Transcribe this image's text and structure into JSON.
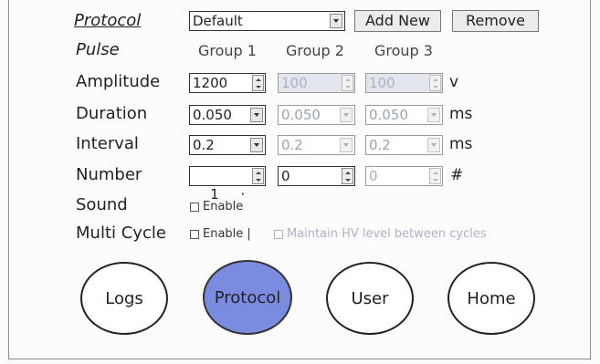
{
  "protocol": {
    "label": "Protocol",
    "selected": "Default",
    "add_new_label": "Add New",
    "remove_label": "Remove"
  },
  "pulse": {
    "label": "Pulse",
    "groups": [
      "Group 1",
      "Group 2",
      "Group 3"
    ]
  },
  "rows": {
    "amplitude": {
      "label": "Amplitude",
      "values": [
        "1200",
        "100",
        "100"
      ],
      "unit": "v"
    },
    "duration": {
      "label": "Duration",
      "values": [
        "0.050",
        "0.050",
        "0.050"
      ],
      "unit": "ms"
    },
    "interval": {
      "label": "Interval",
      "values": [
        "0.2",
        "0.2",
        "0.2"
      ],
      "unit": "ms"
    },
    "number": {
      "label": "Number",
      "values": [
        "1     ·",
        "0",
        "0"
      ],
      "unit": "#"
    }
  },
  "sound": {
    "label": "Sound",
    "enable_label": "Enable"
  },
  "multi_cycle": {
    "label": "Multi Cycle",
    "enable_label": "Enable |",
    "maintain_label": "Maintain HV level between cycles"
  },
  "nav": {
    "logs": "Logs",
    "protocol": "Protocol",
    "user": "User",
    "home": "Home"
  },
  "colors": {
    "active_nav": "#7b8be0",
    "disabled_text": "#a9b3c1"
  }
}
